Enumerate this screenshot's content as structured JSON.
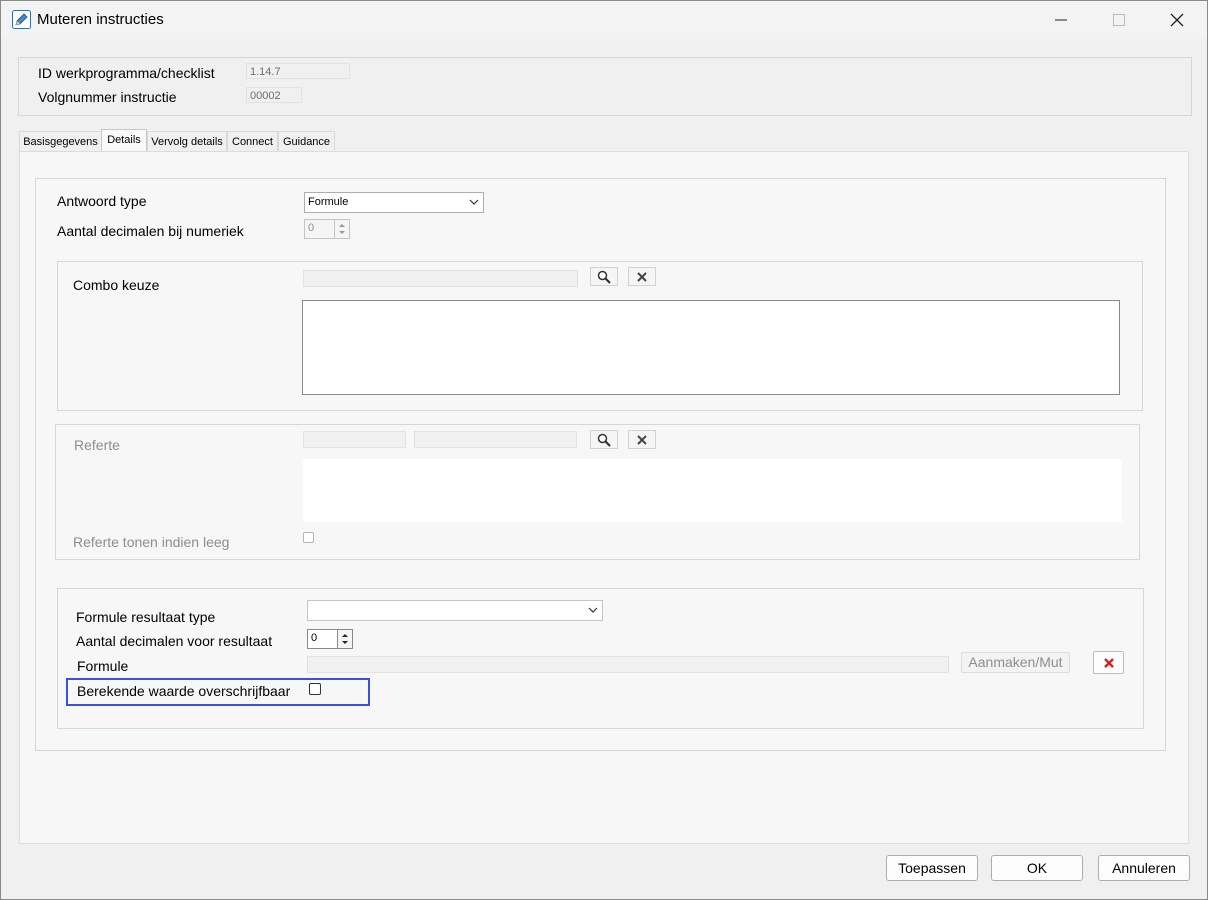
{
  "window": {
    "title": "Muteren instructies"
  },
  "header": {
    "id_label": "ID werkprogramma/checklist",
    "id_value": "1.14.7",
    "volg_label": "Volgnummer instructie",
    "volg_value": "00002"
  },
  "tabs": [
    {
      "label": "Basisgegevens",
      "active": false
    },
    {
      "label": "Details",
      "active": true
    },
    {
      "label": "Vervolg details",
      "active": false
    },
    {
      "label": "Connect",
      "active": false
    },
    {
      "label": "Guidance",
      "active": false
    }
  ],
  "details": {
    "antwoord_type_label": "Antwoord type",
    "antwoord_type_value": "Formule",
    "aantal_decimalen_label": "Aantal decimalen bij  numeriek",
    "aantal_decimalen_value": "0",
    "combo_keuze_label": "Combo keuze",
    "referte_label": "Referte",
    "referte_tonen_label": "Referte tonen indien leeg",
    "formule_resultaat_type_label": "Formule resultaat type",
    "formule_resultaat_type_value": "",
    "aantal_decimalen_resultaat_label": "Aantal decimalen voor resultaat",
    "aantal_decimalen_resultaat_value": "0",
    "formule_label": "Formule",
    "formule_value": "",
    "aanmaken_label": "Aanmaken/Mut",
    "berekende_label": "Berekende waarde overschrijfbaar"
  },
  "footer": {
    "toepassen": "Toepassen",
    "ok": "OK",
    "annuleren": "Annuleren"
  },
  "icons": {
    "search": "search-icon",
    "clear": "clear-icon",
    "delete": "delete-icon",
    "edit": "pencil-icon"
  },
  "colors": {
    "highlight": "#3b4fe0",
    "delete_red": "#d81e1e"
  }
}
